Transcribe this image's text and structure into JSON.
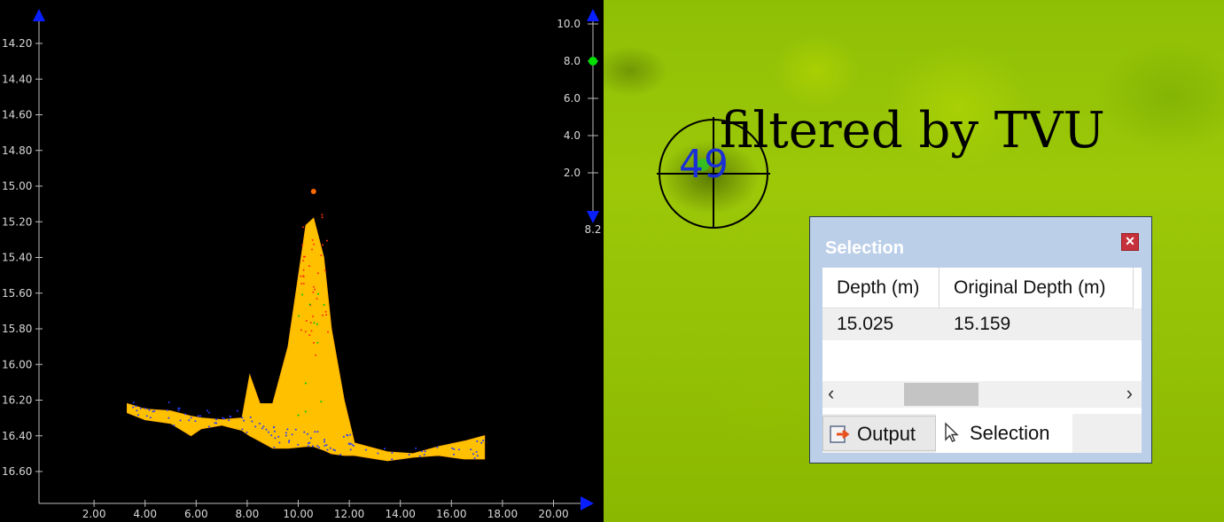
{
  "profile": {
    "y_ticks": [
      "14.20",
      "14.40",
      "14.60",
      "14.80",
      "15.00",
      "15.20",
      "15.40",
      "15.60",
      "15.80",
      "16.00",
      "16.20",
      "16.40",
      "16.60"
    ],
    "x_ticks": [
      "2.00",
      "4.00",
      "6.00",
      "8.00",
      "10.00",
      "12.00",
      "14.00",
      "16.00",
      "18.00",
      "20.00"
    ],
    "scale_ticks": [
      "10.0",
      "8.0",
      "6.0",
      "4.0",
      "2.0"
    ],
    "scale_value": "8.2",
    "scale_marker": 8.0
  },
  "chart_data": {
    "type": "area",
    "x": [
      3.3,
      4.0,
      5.0,
      5.8,
      6.2,
      7.0,
      7.8,
      8.1,
      8.5,
      9.0,
      9.6,
      10.3,
      10.6,
      11.0,
      11.3,
      11.8,
      12.2,
      13.5,
      14.5,
      15.5,
      16.5,
      17.3
    ],
    "y_top": [
      16.22,
      16.25,
      16.26,
      16.29,
      16.3,
      16.31,
      16.3,
      16.06,
      16.22,
      16.22,
      15.9,
      15.22,
      15.18,
      15.4,
      15.8,
      16.2,
      16.44,
      16.49,
      16.5,
      16.46,
      16.43,
      16.4
    ],
    "y_bottom": [
      16.27,
      16.31,
      16.33,
      16.4,
      16.36,
      16.34,
      16.37,
      16.4,
      16.43,
      16.47,
      16.47,
      16.46,
      16.46,
      16.48,
      16.5,
      16.51,
      16.51,
      16.54,
      16.52,
      16.51,
      16.53,
      16.53
    ],
    "outlier": {
      "x": 10.6,
      "y": 15.03
    },
    "ylim": [
      14.1,
      16.75
    ],
    "xlim": [
      0.0,
      21.0
    ],
    "y_inverted": true,
    "grid": false,
    "colors": {
      "fill": "#ffc000",
      "points_blue": "#2a3cff",
      "points_red": "#ff3010",
      "points_green": "#00c400",
      "outlier": "#ff6a00"
    }
  },
  "map": {
    "caption": "filtered by TVU",
    "sounding_number": "49"
  },
  "selection_window": {
    "title": "Selection",
    "close_icon": "close-icon",
    "columns": [
      "Depth (m)",
      "Original Depth (m)"
    ],
    "rows": [
      [
        "15.025",
        "15.159"
      ]
    ],
    "tabs": {
      "output": "Output",
      "selection": "Selection"
    },
    "scroll_left": "‹",
    "scroll_right": "›"
  },
  "colors": {
    "axis_blue": "#0a1fff",
    "scale_marker": "#00e000",
    "window_border": "#2b3b55"
  }
}
